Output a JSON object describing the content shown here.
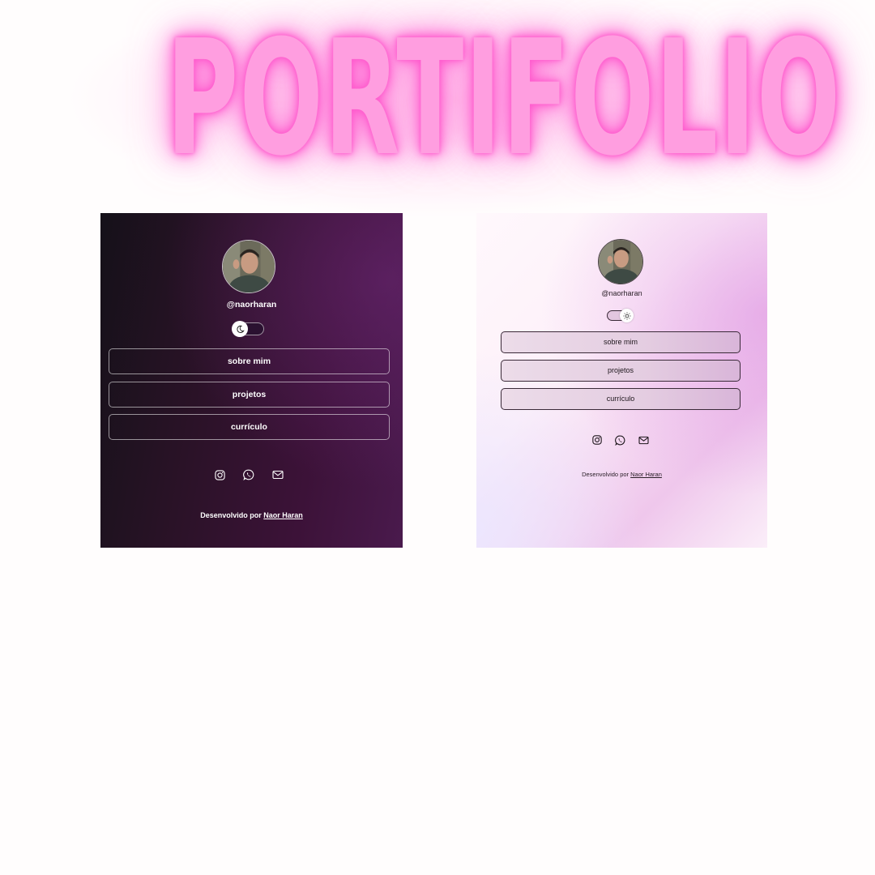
{
  "hero": {
    "title": "PORTIFOLIO"
  },
  "dark_preview": {
    "handle": "@naorharan",
    "theme_toggle_icon": "moon-icon",
    "buttons": [
      {
        "label": "sobre mim"
      },
      {
        "label": "projetos"
      },
      {
        "label": "currículo"
      }
    ],
    "socials": [
      "instagram-icon",
      "whatsapp-icon",
      "mail-icon"
    ],
    "footer_prefix": "Desenvolvido por",
    "footer_link": "Naor Haran"
  },
  "light_preview": {
    "handle": "@naorharan",
    "theme_toggle_icon": "sun-icon",
    "buttons": [
      {
        "label": "sobre mim"
      },
      {
        "label": "projetos"
      },
      {
        "label": "currículo"
      }
    ],
    "socials": [
      "instagram-icon",
      "whatsapp-icon",
      "mail-icon"
    ],
    "footer_prefix": "Desenvolvido por",
    "footer_link": "Naor Haran"
  },
  "colors": {
    "title_pink": "#ff9ee0",
    "glow_pink": "#ff4fc8",
    "dark_bg": "#2a1227",
    "light_accent": "#efc7ec"
  }
}
